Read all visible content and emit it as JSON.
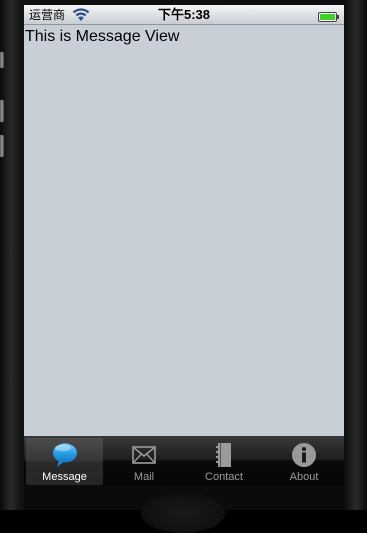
{
  "status_bar": {
    "carrier": "运营商",
    "time": "下午5:38",
    "icons": [
      "wifi-icon",
      "battery-icon"
    ],
    "battery_color": "#3ed22a"
  },
  "content": {
    "text": "This is Message View"
  },
  "tabbar": {
    "tabs": [
      {
        "label": "Message",
        "icon": "speech-bubble-icon",
        "selected": true
      },
      {
        "label": "Mail",
        "icon": "envelope-icon",
        "selected": false
      },
      {
        "label": "Contact",
        "icon": "notebook-icon",
        "selected": false
      },
      {
        "label": "About",
        "icon": "info-icon",
        "selected": false
      }
    ],
    "selected_icon_color": "#2aa0e6"
  }
}
